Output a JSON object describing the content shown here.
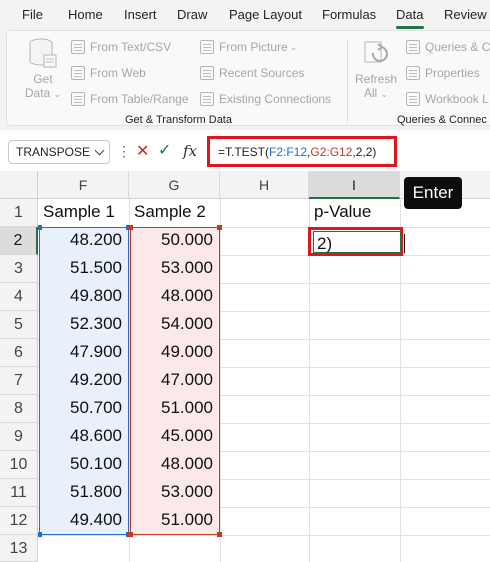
{
  "menu": {
    "tabs": [
      "File",
      "Home",
      "Insert",
      "Draw",
      "Page Layout",
      "Formulas",
      "Data",
      "Review"
    ],
    "active_tab": "Data"
  },
  "ribbon": {
    "get_data": {
      "line1": "Get",
      "line2": "Data"
    },
    "get_transform_items": [
      "From Text/CSV",
      "From Web",
      "From Table/Range"
    ],
    "get_transform_items_2": [
      "From Picture",
      "Recent Sources",
      "Existing Connections"
    ],
    "group1_label": "Get & Transform Data",
    "refresh_all": {
      "line1": "Refresh",
      "line2": "All"
    },
    "queries_items": [
      "Queries & C",
      "Properties",
      "Workbook L"
    ],
    "group2_label": "Queries & Connec"
  },
  "formula_bar": {
    "name_box": "TRANSPOSE",
    "fx_label": "fx",
    "formula_parts": {
      "prefix": "=T.TEST(",
      "ref1": "F2:F12",
      "sep1": ",",
      "ref2": "G2:G12",
      "suffix": ",2,2)"
    }
  },
  "sheet": {
    "columns": [
      "F",
      "G",
      "H",
      "I"
    ],
    "selected_column": "I",
    "rows": [
      "1",
      "2",
      "3",
      "4",
      "5",
      "6",
      "7",
      "8",
      "9",
      "10",
      "11",
      "12",
      "13"
    ],
    "selected_row": "2",
    "headers": {
      "F1": "Sample 1",
      "G1": "Sample 2",
      "I1": "p-Value"
    },
    "sample1": [
      "48.200",
      "51.500",
      "49.800",
      "52.300",
      "47.900",
      "49.200",
      "50.700",
      "48.600",
      "50.100",
      "51.800",
      "49.400"
    ],
    "sample2": [
      "50.000",
      "53.000",
      "48.000",
      "54.000",
      "49.000",
      "47.000",
      "51.000",
      "45.000",
      "48.000",
      "53.000",
      "51.000"
    ],
    "active_cell_text": "2)"
  },
  "overlay": {
    "key_label": "Enter"
  },
  "colors": {
    "accent": "#217346",
    "highlight_red": "#e0161c",
    "ref_blue": "#1f6fbf",
    "ref_red": "#c0392b"
  }
}
